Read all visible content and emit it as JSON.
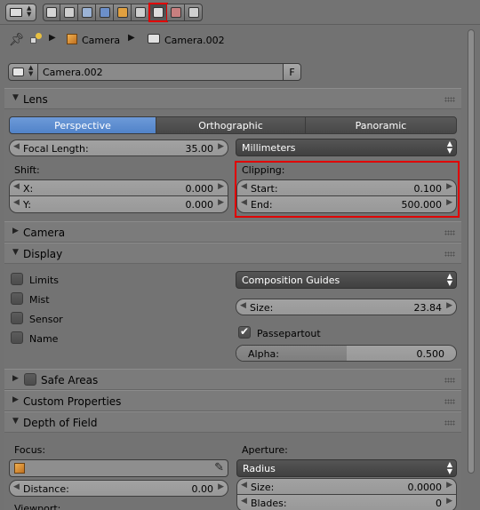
{
  "header": {
    "editor_icon": "properties-editor-icon",
    "context_tabs": [
      {
        "icon": "render-icon",
        "color": "#d6d6d6"
      },
      {
        "icon": "render-layers-icon",
        "color": "#cfcfcf"
      },
      {
        "icon": "scene-icon",
        "color": "#9bb3d6"
      },
      {
        "icon": "world-icon",
        "color": "#6c8fc9"
      },
      {
        "icon": "object-icon",
        "color": "#e0a040"
      },
      {
        "icon": "constraints-icon",
        "color": "#cfcfcf"
      },
      {
        "icon": "camera-data-icon",
        "color": "#dcdcdc",
        "active": true
      },
      {
        "icon": "texture-icon",
        "color": "#c87f7f"
      },
      {
        "icon": "particles-icon",
        "color": "#cfcfcf"
      }
    ]
  },
  "breadcrumb": {
    "object_name": "Camera",
    "data_name": "Camera.002"
  },
  "datablock": {
    "name": "Camera.002",
    "fake_user_label": "F"
  },
  "lens_panel": {
    "title": "Lens",
    "projection_tabs": [
      "Perspective",
      "Orthographic",
      "Panoramic"
    ],
    "active_projection": "Perspective",
    "focal_length_label": "Focal Length:",
    "focal_length_value": "35.00",
    "lens_unit": "Millimeters",
    "shift_label": "Shift:",
    "shift_x_label": "X:",
    "shift_x_value": "0.000",
    "shift_y_label": "Y:",
    "shift_y_value": "0.000",
    "clipping_label": "Clipping:",
    "clip_start_label": "Start:",
    "clip_start_value": "0.100",
    "clip_end_label": "End:",
    "clip_end_value": "500.000"
  },
  "camera_panel": {
    "title": "Camera"
  },
  "display_panel": {
    "title": "Display",
    "checkboxes": [
      "Limits",
      "Mist",
      "Sensor",
      "Name"
    ],
    "guides": "Composition Guides",
    "size_label": "Size:",
    "size_value": "23.84",
    "passepartout_label": "Passepartout",
    "alpha_label": "Alpha:",
    "alpha_value": "0.500",
    "alpha_fraction": 0.5
  },
  "safe_areas_panel": {
    "title": "Safe Areas"
  },
  "custom_props_panel": {
    "title": "Custom Properties"
  },
  "dof_panel": {
    "title": "Depth of Field",
    "focus_label": "Focus:",
    "distance_label": "Distance:",
    "distance_value": "0.00",
    "viewport_label": "Viewport:",
    "aperture_label": "Aperture:",
    "aperture_type": "Radius",
    "size_label": "Size:",
    "size_value": "0.0000",
    "blades_label": "Blades:",
    "blades_value": "0"
  }
}
